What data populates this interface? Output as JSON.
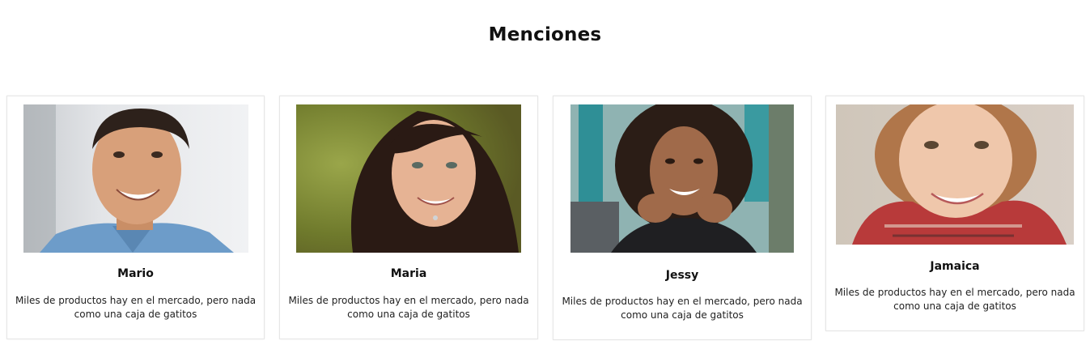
{
  "section": {
    "title": "Menciones"
  },
  "cards": [
    {
      "name": "Mario",
      "desc_line1": "Miles de productos hay en el mercado, pero nada",
      "desc_line2": "como una caja de gatitos",
      "photo_icon": "portrait-photo"
    },
    {
      "name": "Maria",
      "desc_line1": "Miles de productos hay en el mercado, pero nada",
      "desc_line2": "como una caja de gatitos",
      "photo_icon": "portrait-photo"
    },
    {
      "name": "Jessy",
      "desc_line1": "Miles de productos hay en el mercado, pero nada",
      "desc_line2": "como una caja de gatitos",
      "photo_icon": "portrait-photo"
    },
    {
      "name": "Jamaica",
      "desc_line1": "Miles de productos hay en el mercado, pero nada",
      "desc_line2": "como una caja de gatitos",
      "photo_icon": "portrait-photo"
    }
  ],
  "colors": {
    "text": "#111111",
    "card_border": "#e6e6e6",
    "background": "#ffffff"
  }
}
